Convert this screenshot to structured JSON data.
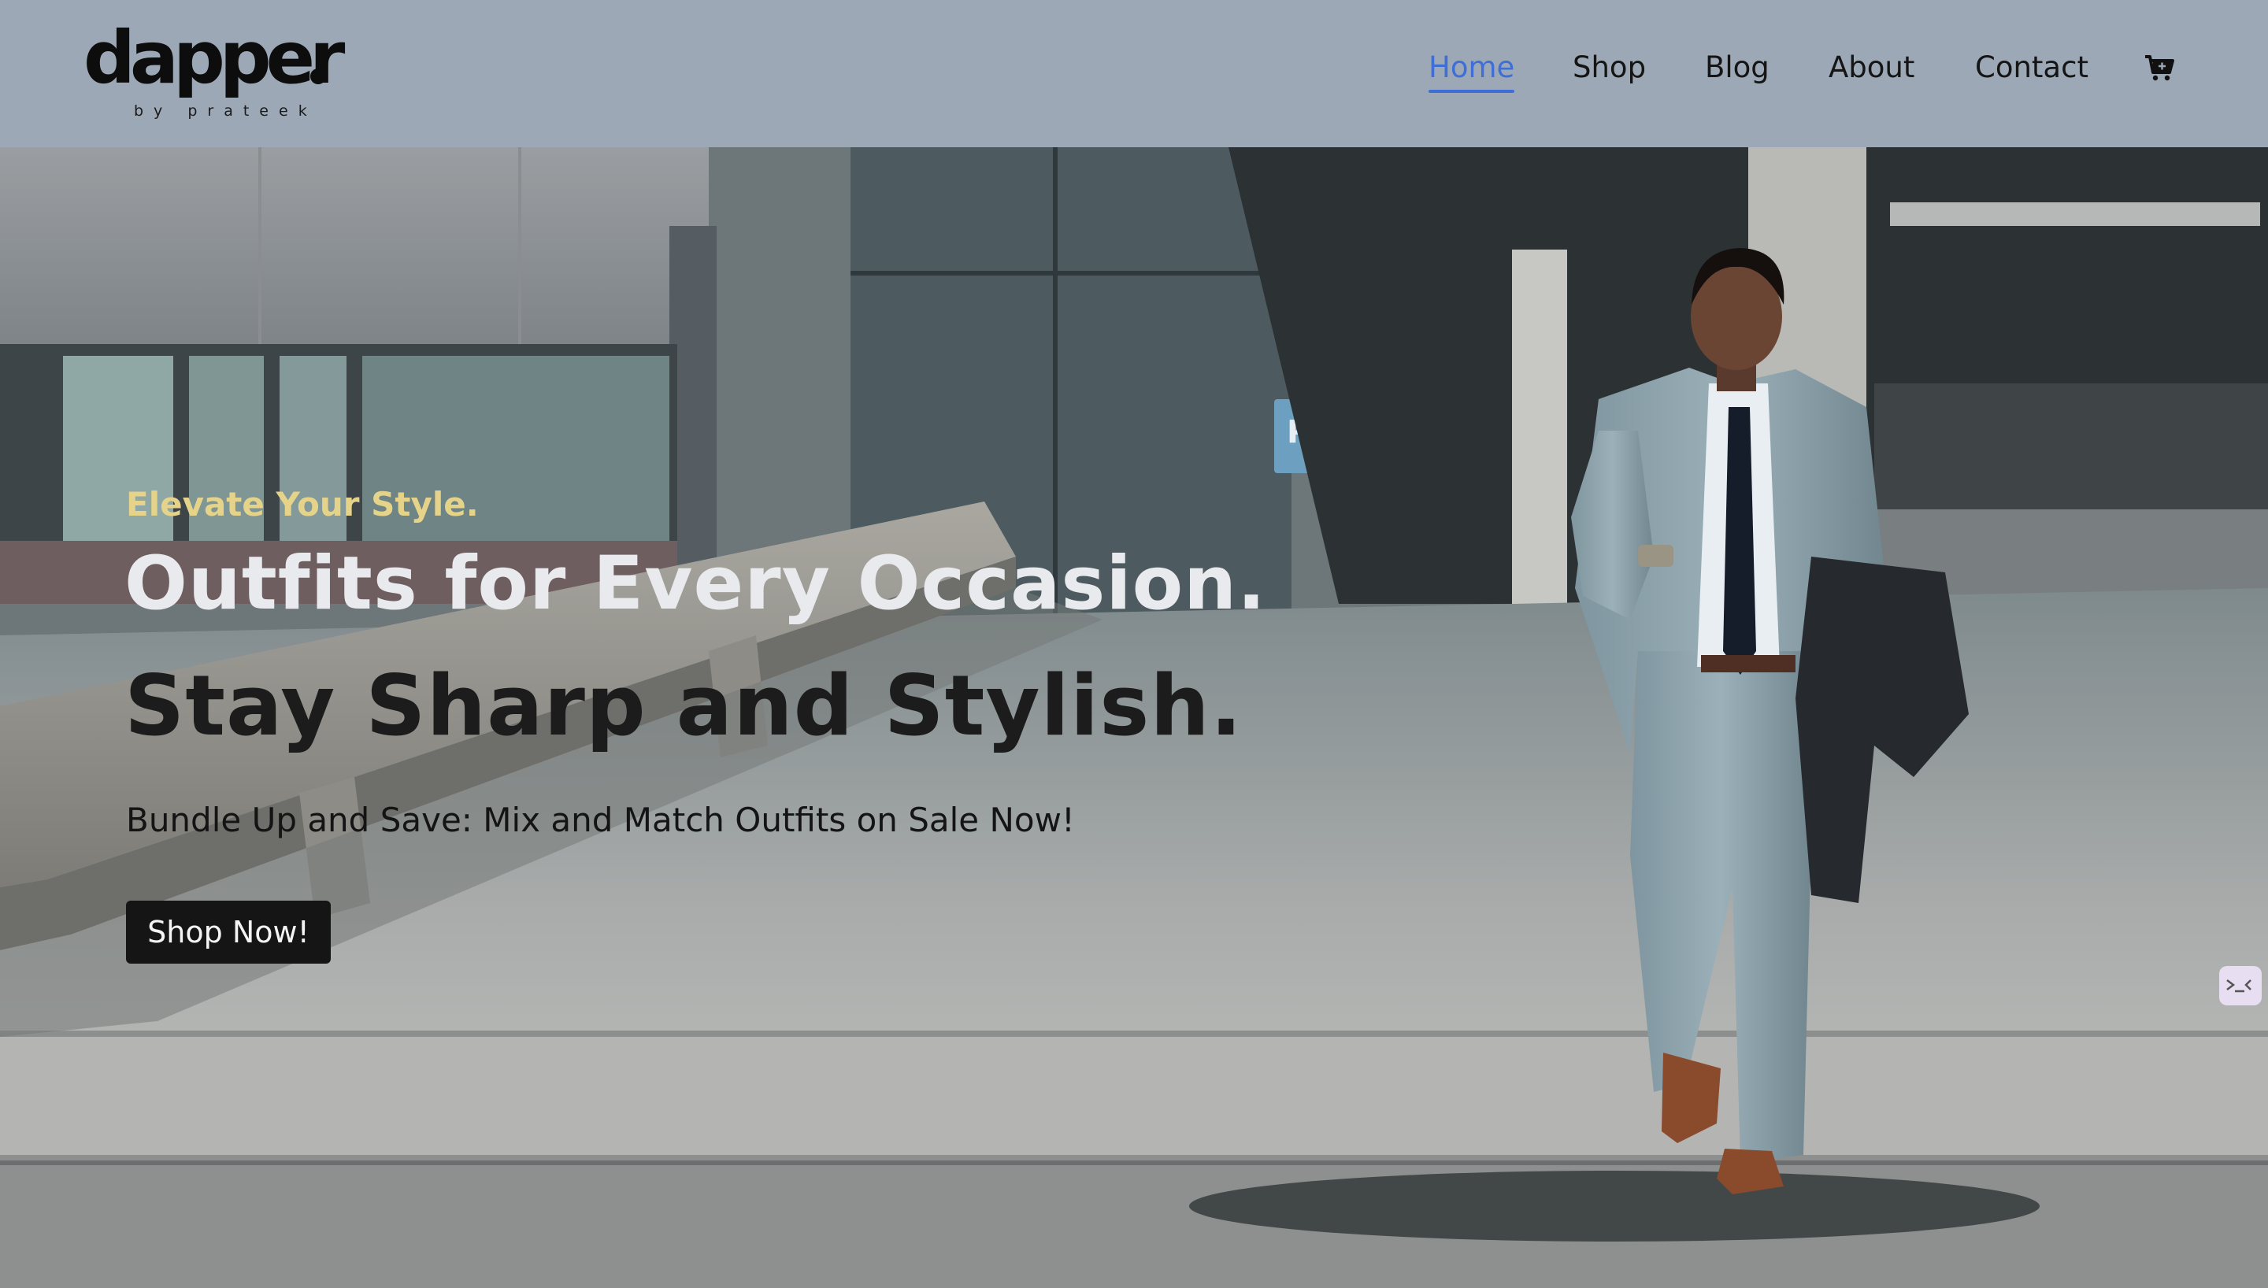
{
  "brand": {
    "name": "dapper",
    "tagline": "by prateek"
  },
  "nav": {
    "items": [
      {
        "label": "Home",
        "active": true
      },
      {
        "label": "Shop",
        "active": false
      },
      {
        "label": "Blog",
        "active": false
      },
      {
        "label": "About",
        "active": false
      },
      {
        "label": "Contact",
        "active": false
      }
    ],
    "cart_icon": "cart-icon"
  },
  "hero": {
    "eyebrow": "Elevate Your Style.",
    "headline_line1": "Outfits for Every Occasion.",
    "headline_line2": "Stay Sharp and Stylish.",
    "subtext": "Bundle Up and Save: Mix and Match Outfits on Sale Now!",
    "cta_label": "Shop Now!",
    "image_description": "man in grey suit walking while looking at phone"
  },
  "colors": {
    "header_bg": "#9ca8b6",
    "active_nav": "#3f6fd6",
    "eyebrow": "#e6d38a",
    "headline_light": "#e9eaed",
    "headline_dark": "#1c1c1c",
    "cta_bg": "#151515"
  }
}
